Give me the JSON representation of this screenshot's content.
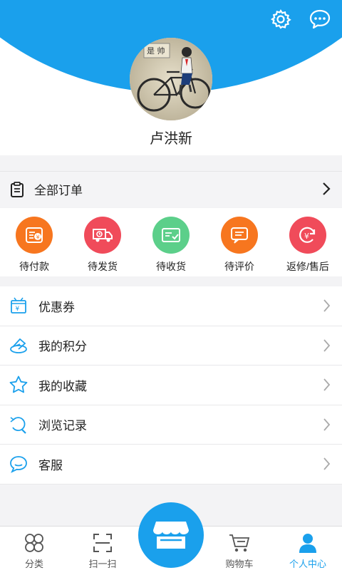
{
  "header": {
    "settings_icon": "gear-icon",
    "message_icon": "chat-bubble-icon",
    "accent": "#1aa0ec"
  },
  "user": {
    "name": "卢洪新",
    "avatar_sign_text": "是 帅"
  },
  "orders": {
    "all_label": "全部订单",
    "status": [
      {
        "label": "待付款",
        "icon": "wallet-icon",
        "color": "#f7761f"
      },
      {
        "label": "待发货",
        "icon": "truck-icon",
        "color": "#f04b5a"
      },
      {
        "label": "待收货",
        "icon": "card-check-icon",
        "color": "#5ccf8a"
      },
      {
        "label": "待评价",
        "icon": "comment-icon",
        "color": "#f7761f"
      },
      {
        "label": "返修/售后",
        "icon": "refund-icon",
        "color": "#f04b5a"
      }
    ]
  },
  "menu": [
    {
      "label": "优惠券",
      "icon": "coupon-icon"
    },
    {
      "label": "我的积分",
      "icon": "points-icon"
    },
    {
      "label": "我的收藏",
      "icon": "star-icon"
    },
    {
      "label": "浏览记录",
      "icon": "history-icon"
    },
    {
      "label": "客服",
      "icon": "service-icon"
    }
  ],
  "nav": [
    {
      "label": "分类",
      "icon": "category-icon"
    },
    {
      "label": "扫一扫",
      "icon": "scan-icon"
    },
    {
      "label": "购物车",
      "icon": "cart-icon"
    },
    {
      "label": "个人中心",
      "icon": "person-icon",
      "active": true
    }
  ]
}
